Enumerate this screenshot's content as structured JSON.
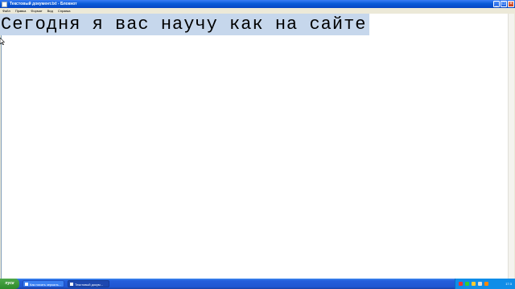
{
  "window": {
    "title": "Текстовый документ.txt - Блокнот",
    "controls": {
      "minimize": "_",
      "maximize": "□",
      "close": "×"
    }
  },
  "menu": [
    "Файл",
    "Правка",
    "Формат",
    "Вид",
    "Справка"
  ],
  "editor": {
    "selected_text": "Сегодня я вас научу как на сайте"
  },
  "taskbar": {
    "start_label": "пуск",
    "tasks": [
      {
        "label": "Как писать зеркаль..."
      },
      {
        "label": "Текстовый докум..."
      }
    ],
    "clock": "17:3"
  },
  "colors": {
    "selection": "#c6d7ec",
    "titlebar": "#0a5bd8",
    "taskbar": "#245edb"
  }
}
